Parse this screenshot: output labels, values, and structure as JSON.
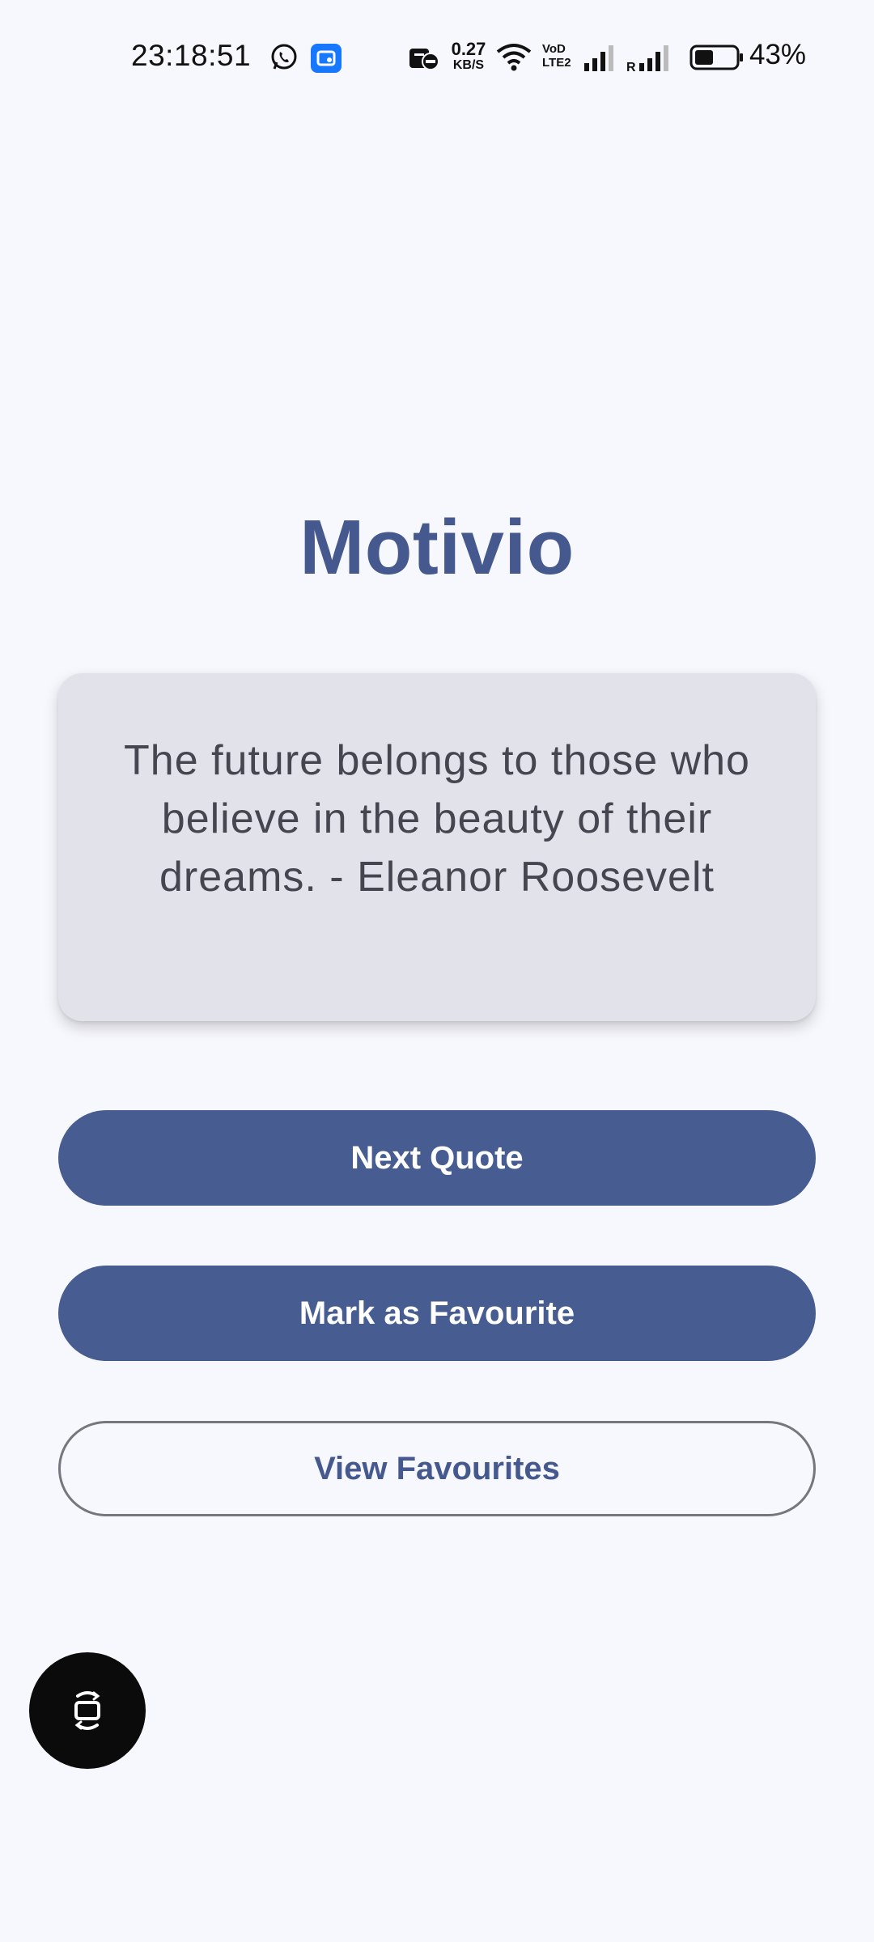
{
  "status_bar": {
    "time": "23:18:51",
    "net_speed_value": "0.27",
    "net_speed_unit": "KB/S",
    "volte_line1": "VoD",
    "volte_line2": "LTE2",
    "battery_percent": "43%",
    "icons": [
      "whatsapp-icon",
      "app-notification-icon",
      "do-not-disturb-icon",
      "wifi-icon",
      "signal-icon",
      "roaming-signal-icon",
      "battery-icon"
    ]
  },
  "app": {
    "title": "Motivio",
    "quote": "The future belongs to those who believe in the beauty of their dreams. - Eleanor Roosevelt"
  },
  "buttons": {
    "next": "Next Quote",
    "favourite": "Mark as Favourite",
    "view_favourites": "View Favourites"
  },
  "floating": {
    "icon": "screen-rotate-icon"
  },
  "colors": {
    "background": "#f7f8fd",
    "accent": "#475d91",
    "card": "#e2e2ea"
  }
}
